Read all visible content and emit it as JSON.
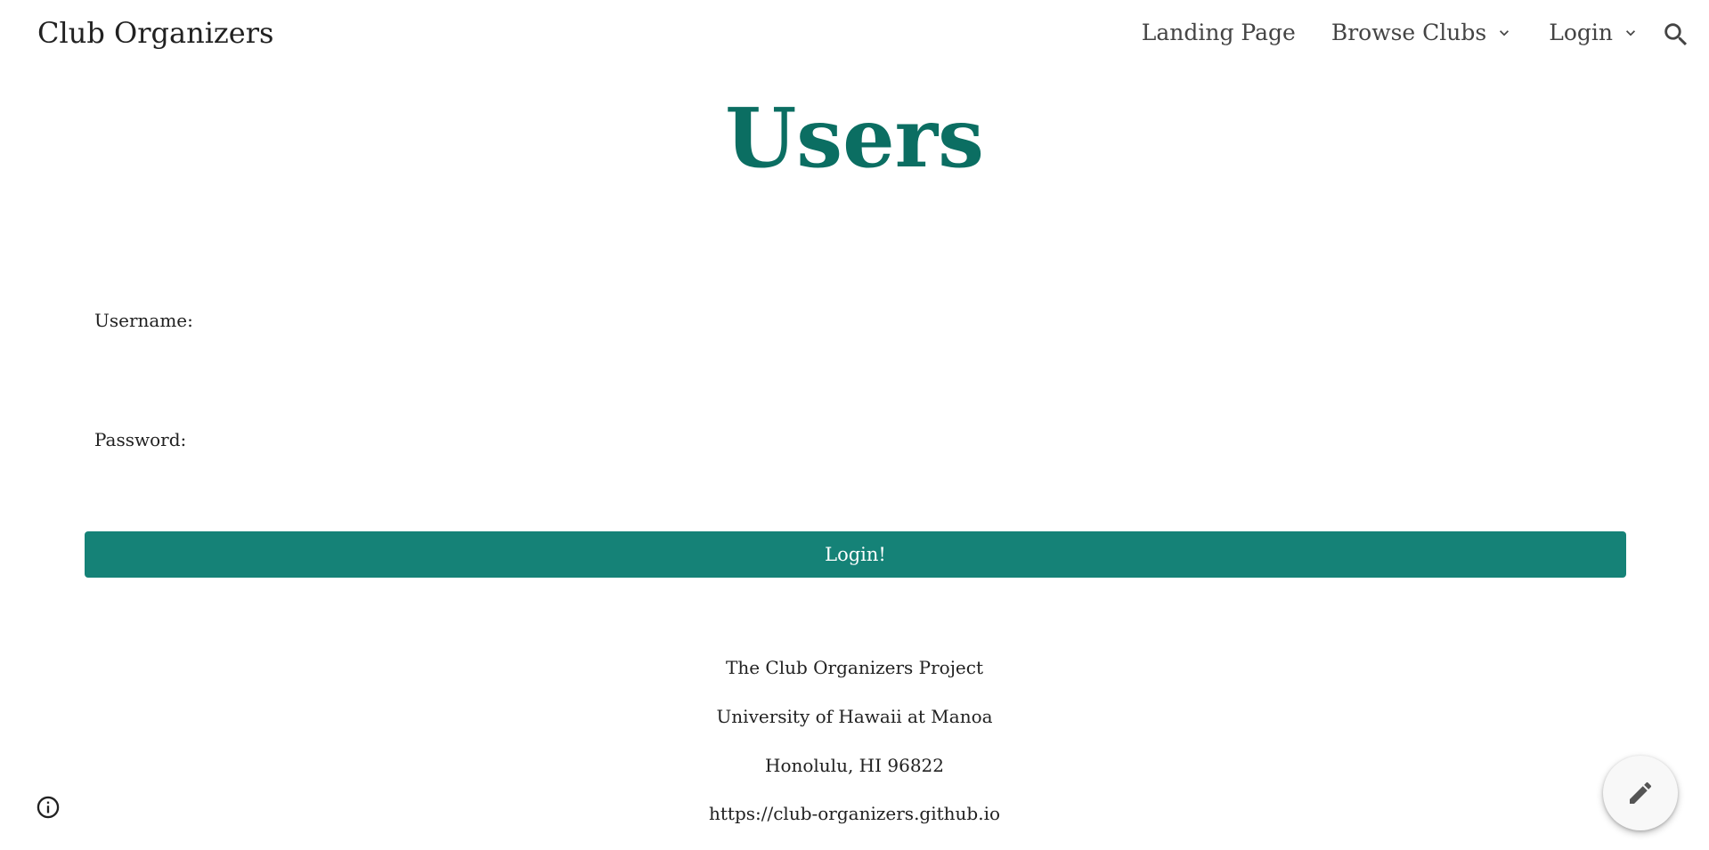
{
  "header": {
    "site_title": "Club Organizers",
    "nav": [
      {
        "label": "Landing Page",
        "has_dropdown": false
      },
      {
        "label": "Browse Clubs",
        "has_dropdown": true
      },
      {
        "label": "Login",
        "has_dropdown": true
      }
    ],
    "search_icon": "search-icon"
  },
  "main": {
    "heading": "Users",
    "username_label": "Username:",
    "username_value": "",
    "password_label": "Password:",
    "password_value": "",
    "login_button": "Login!"
  },
  "footer": {
    "lines": [
      "The Club Organizers Project",
      "University of Hawaii at Manoa",
      "Honolulu, HI 96822",
      "https://club-organizers.github.io"
    ]
  },
  "colors": {
    "accent": "#158277",
    "heading": "#0b6e62"
  },
  "icons": {
    "info": "info-icon",
    "edit": "pencil-icon"
  }
}
